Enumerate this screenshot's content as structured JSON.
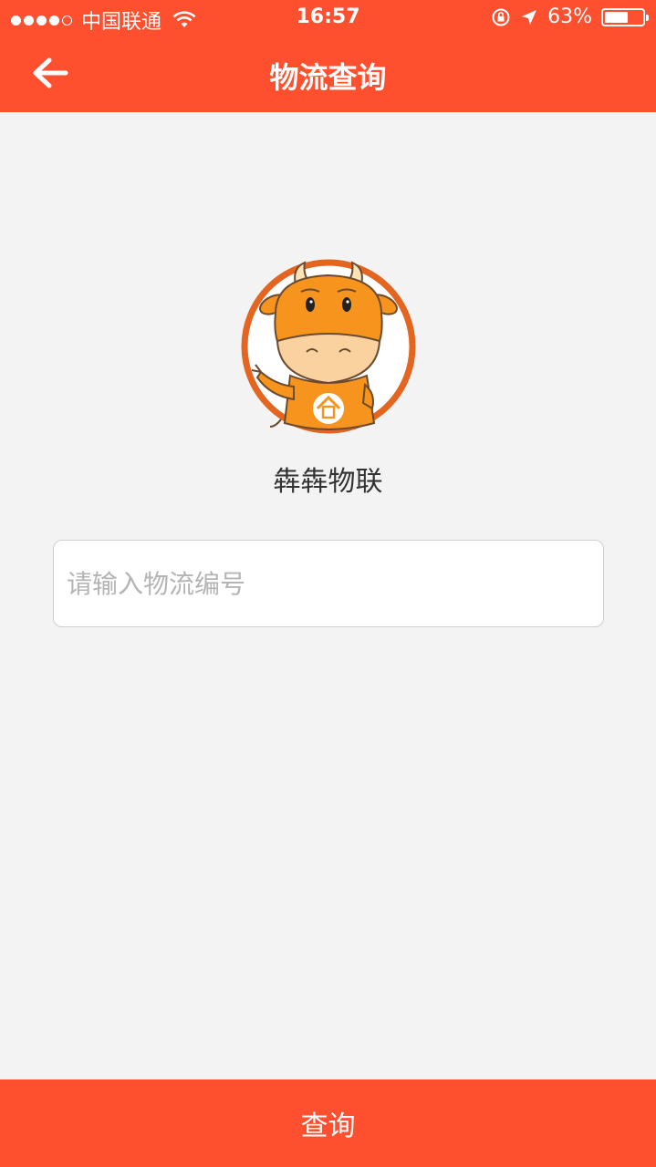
{
  "status_bar": {
    "carrier": "中国联通",
    "time": "16:57",
    "battery_percent_label": "63%",
    "battery_level": 0.63,
    "signal_bars": 4,
    "icons": [
      "signal-dots-icon",
      "wifi-icon",
      "orientation-lock-icon",
      "location-arrow-icon",
      "battery-icon"
    ]
  },
  "nav": {
    "title": "物流查询",
    "back_icon": "back-arrow-icon"
  },
  "brand": {
    "name": "犇犇物联",
    "logo_icon": "cow-mascot-logo"
  },
  "search": {
    "placeholder": "请输入物流编号",
    "value": ""
  },
  "query_button": {
    "label": "查询"
  },
  "colors": {
    "accent": "#fe4f2e",
    "background": "#f3f3f3",
    "logo_orange": "#f7941d"
  }
}
